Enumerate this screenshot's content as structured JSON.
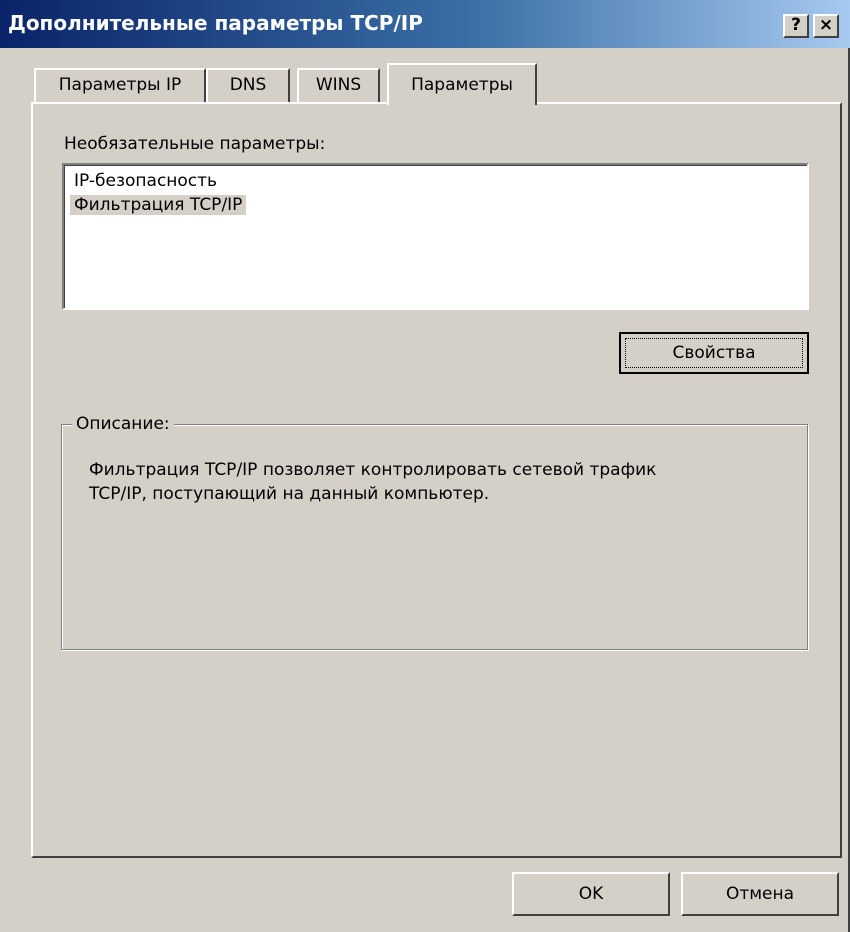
{
  "window": {
    "title": "Дополнительные параметры TCP/IP",
    "help_btn": "?",
    "close_btn": "×"
  },
  "tabs": [
    {
      "label": "Параметры IP"
    },
    {
      "label": "DNS"
    },
    {
      "label": "WINS"
    },
    {
      "label": "Параметры"
    }
  ],
  "options": {
    "label": "Необязательные параметры:",
    "items": [
      {
        "label": "IP-безопасность"
      },
      {
        "label": "Фильтрация TCP/IP",
        "selected": true
      }
    ],
    "properties_button": "Свойства"
  },
  "description": {
    "title": "Описание:",
    "lines": [
      "Фильтрация TCP/IP позволяет контролировать сетевой трафик",
      "TCP/IP,  поступающий на данный компьютер."
    ]
  },
  "footer": {
    "ok": "OK",
    "cancel": "Отмена"
  }
}
